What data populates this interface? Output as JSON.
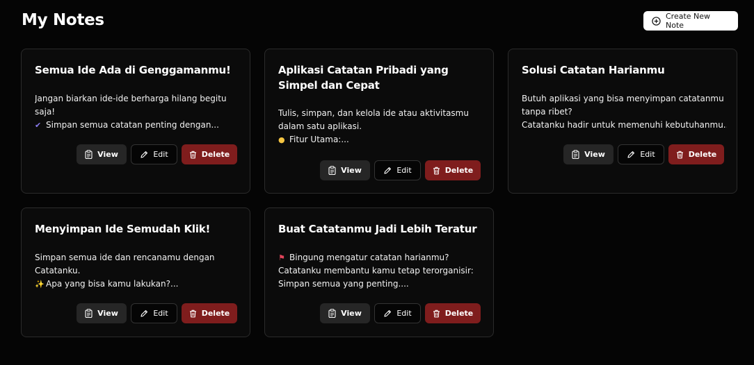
{
  "header": {
    "title": "My Notes",
    "create_label": "Create New Note"
  },
  "buttons": {
    "view": "View",
    "edit": "Edit",
    "delete": "Delete"
  },
  "notes": [
    {
      "title": "Semua Ide Ada di Genggamanmu!",
      "lines": [
        "Jangan biarkan ide-ide berharga hilang begitu",
        "saja!",
        "Simpan semua catatan penting dengan..."
      ],
      "emoji": "✔"
    },
    {
      "title": "Aplikasi Catatan Pribadi yang Simpel dan Cepat",
      "lines": [
        "Tulis, simpan, dan kelola ide atau aktivitasmu",
        "dalam satu aplikasi.",
        "Fitur Utama:..."
      ],
      "emoji": "💡"
    },
    {
      "title": "Solusi Catatan Harianmu",
      "lines": [
        "Butuh aplikasi yang bisa menyimpan catatanmu",
        "tanpa ribet?",
        "Catatanku hadir untuk memenuhi kebutuhanmu..."
      ],
      "emoji": ""
    },
    {
      "title": "Menyimpan Ide Semudah Klik!",
      "lines": [
        "Simpan semua ide dan rencanamu dengan",
        "Catatanku.",
        "Apa yang bisa kamu lakukan?..."
      ],
      "emoji": "✨"
    },
    {
      "title": "Buat Catatanmu Jadi Lebih Teratur",
      "lines": [
        "Bingung mengatur catatan harianmu?",
        "Catatanku membantu kamu tetap terorganisir:",
        "Simpan semua yang penting...."
      ],
      "emoji": "📌"
    }
  ],
  "colors": {
    "background": "#050505",
    "card_border": "#2b2b2b",
    "view_bg": "#262626",
    "delete_bg": "#7f1d1d",
    "check": "#8b7cf0"
  }
}
